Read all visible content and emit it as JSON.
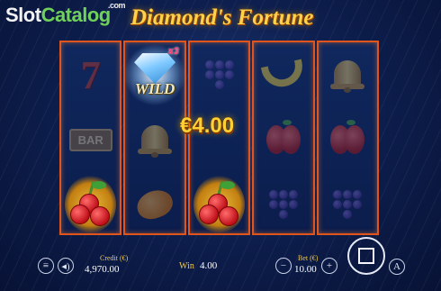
{
  "header": {
    "watermark_part1": "Slot",
    "watermark_part2": "Catalog",
    "watermark_domain": ".com",
    "game_title": "Diamond's Fortune"
  },
  "reels": [
    {
      "symbols": [
        "seven-icon",
        "bar-icon",
        "cherries-icon"
      ],
      "labels": [
        "7",
        "BAR",
        ""
      ]
    },
    {
      "symbols": [
        "wild-diamond-icon",
        "bell-icon",
        "orange-icon"
      ],
      "labels": [
        "WILD",
        "",
        ""
      ]
    },
    {
      "symbols": [
        "grapes-icon",
        "blank",
        "cherries-icon"
      ],
      "labels": [
        "",
        "",
        ""
      ]
    },
    {
      "symbols": [
        "banana-icon",
        "apple-icon",
        "grapes-icon"
      ],
      "labels": [
        "",
        "",
        ""
      ]
    },
    {
      "symbols": [
        "bell-icon",
        "apple-icon",
        "grapes-icon"
      ],
      "labels": [
        "",
        "",
        ""
      ]
    }
  ],
  "wild_multiplier": "x3",
  "win_amount": "€4.00",
  "bottom_bar": {
    "credit_label": "Credit (€)",
    "credit_value": "4,970.00",
    "win_label": "Win",
    "win_value": "4.00",
    "bet_label": "Bet (€)",
    "bet_value": "10.00",
    "minus": "−",
    "plus": "+",
    "autoplay": "A"
  },
  "colors": {
    "background": "#0e1f4f",
    "reel_border": "#e0551b",
    "accent_gold": "#ffd033",
    "label_gold": "#f2c94c"
  }
}
